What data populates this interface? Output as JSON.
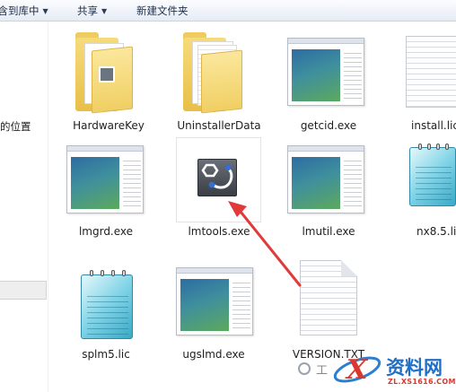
{
  "toolbar": {
    "items": [
      {
        "label": "包含到库中",
        "has_dropdown": true
      },
      {
        "label": "共享",
        "has_dropdown": true
      },
      {
        "label": "新建文件夹",
        "has_dropdown": false
      }
    ]
  },
  "nav": {
    "partial_item": "的位置"
  },
  "files": [
    {
      "name": "HardwareKey",
      "kind": "folder"
    },
    {
      "name": "UninstallerData",
      "kind": "folder"
    },
    {
      "name": "getcid.exe",
      "kind": "exe"
    },
    {
      "name": "install.lic",
      "kind": "text-document"
    },
    {
      "name": "lmgrd.exe",
      "kind": "exe"
    },
    {
      "name": "lmtools.exe",
      "kind": "exe",
      "selected": true
    },
    {
      "name": "lmutil.exe",
      "kind": "exe"
    },
    {
      "name": "nx8.5.lic",
      "kind": "notepad-document"
    },
    {
      "name": "splm5.lic",
      "kind": "notepad-document"
    },
    {
      "name": "ugslmd.exe",
      "kind": "exe"
    },
    {
      "name": "VERSION.TXT",
      "kind": "text-document"
    }
  ],
  "annotation": {
    "arrow_color": "#e03a3a"
  },
  "watermark": {
    "channel_text": "工",
    "brand_cn": "资料网",
    "brand_url": "ZL.XS1616.COM"
  },
  "colors": {
    "toolbar_bg": "#e6ecf5",
    "selection_border": "#e3e3e3",
    "watermark_blue": "#1f6fc7",
    "watermark_red": "#d9382f"
  }
}
